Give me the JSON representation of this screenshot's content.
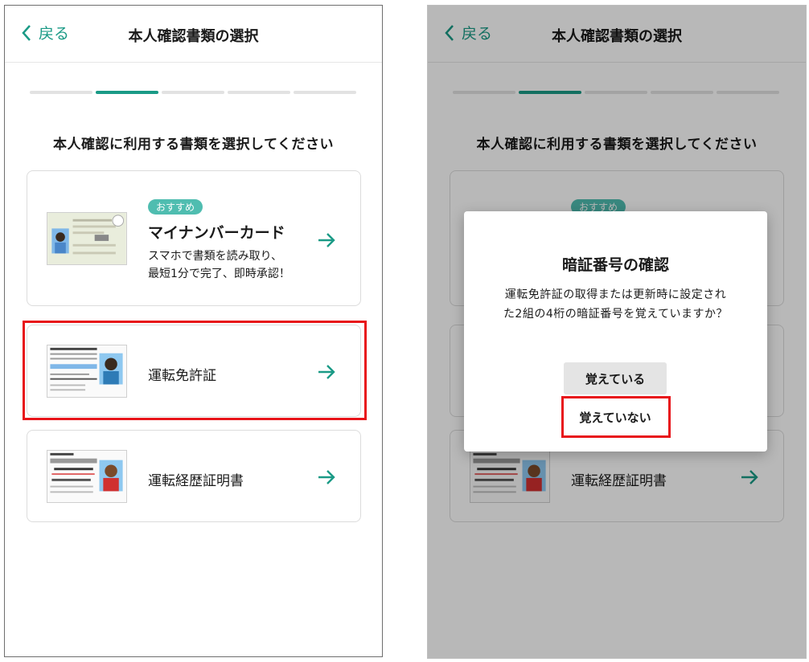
{
  "header": {
    "back_label": "戻る",
    "title": "本人確認書類の選択"
  },
  "steps": {
    "total": 5,
    "current": 2
  },
  "prompt": "本人確認に利用する書類を選択してください",
  "documents": [
    {
      "badge": "おすすめ",
      "title": "マイナンバーカード",
      "desc_line1": "スマホで書類を読み取り、",
      "desc_line2": "最短1分で完了、即時承認！",
      "icon": "my-number-card-icon"
    },
    {
      "label": "運転免許証",
      "icon": "drivers-license-icon"
    },
    {
      "label": "運転経歴証明書",
      "icon": "driving-history-certificate-icon"
    }
  ],
  "dialog": {
    "title": "暗証番号の確認",
    "body_line1": "運転免許証の取得または更新時に設定され",
    "body_line2": "た2組の4桁の暗証番号を覚えていますか？",
    "remember_label": "覚えている",
    "not_remember_label": "覚えていない"
  },
  "colors": {
    "accent": "#1a9a86",
    "badge": "#4fbdb0",
    "highlight": "#e8141a"
  }
}
